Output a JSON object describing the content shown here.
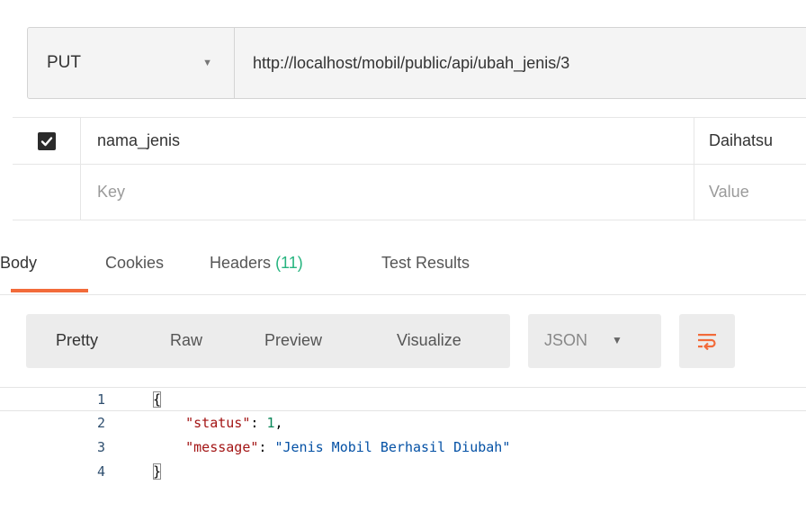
{
  "request": {
    "method": "PUT",
    "url": "http://localhost/mobil/public/api/ubah_jenis/3"
  },
  "params": {
    "rows": [
      {
        "checked": true,
        "key": "nama_jenis",
        "value": "Daihatsu"
      }
    ],
    "placeholder_row": {
      "key": "Key",
      "value": "Value"
    }
  },
  "response_tabs": {
    "body": "Body",
    "cookies": "Cookies",
    "headers": "Headers",
    "headers_count": "(11)",
    "test_results": "Test Results",
    "active": "Body"
  },
  "view_toolbar": {
    "pretty": "Pretty",
    "raw": "Raw",
    "preview": "Preview",
    "visualize": "Visualize",
    "format": "JSON",
    "active": "Pretty",
    "wrap_icon": "wrap-lines-icon"
  },
  "response_body": {
    "line_numbers": [
      "1",
      "2",
      "3",
      "4"
    ],
    "open_brace": "{",
    "close_brace": "}",
    "status_key": "\"status\"",
    "status_value": "1",
    "message_key": "\"message\"",
    "message_value": "\"Jenis Mobil Berhasil Diubah\""
  },
  "colors": {
    "accent_tab": "#f26b3a",
    "headers_count": "#26b47f",
    "json_key": "#a31515",
    "json_string": "#0451a5",
    "json_number": "#098658"
  }
}
